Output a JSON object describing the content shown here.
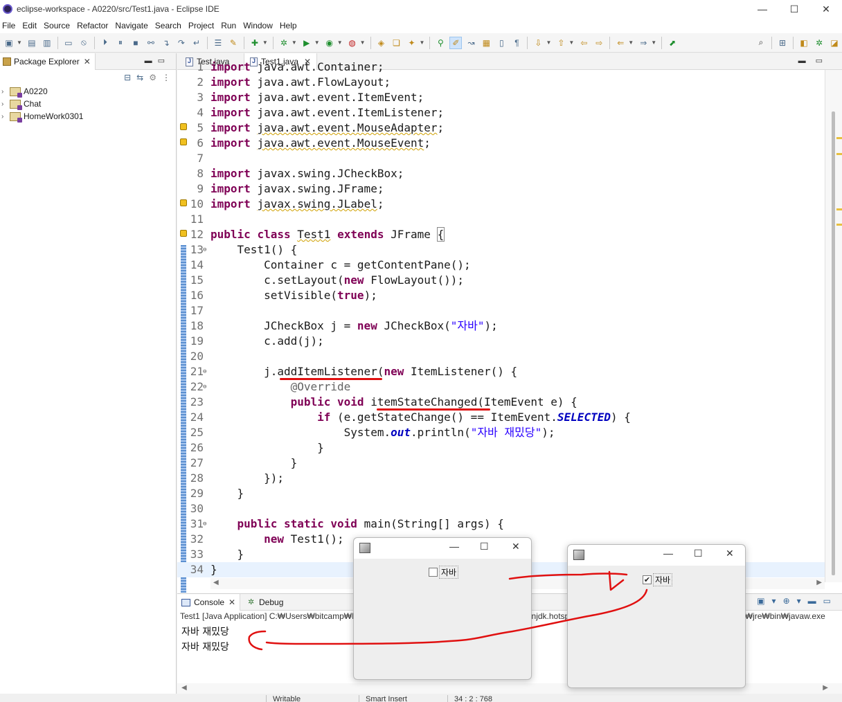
{
  "window": {
    "title": "eclipse-workspace - A0220/src/Test1.java - Eclipse IDE",
    "minimize": "—",
    "maximize": "☐",
    "close": "✕"
  },
  "menu": [
    "File",
    "Edit",
    "Source",
    "Refactor",
    "Navigate",
    "Search",
    "Project",
    "Run",
    "Window",
    "Help"
  ],
  "package_explorer": {
    "title": "Package Explorer",
    "close": "✕",
    "projects": [
      "A0220",
      "Chat",
      "HomeWork0301"
    ]
  },
  "editor": {
    "tabs": [
      {
        "label": "Test.java",
        "active": false
      },
      {
        "label": "Test1.java",
        "active": true,
        "close": "✕"
      }
    ],
    "lines": [
      {
        "n": "1",
        "html": "<span class=\"kw\">import</span> java.awt.Container;"
      },
      {
        "n": "2",
        "html": "<span class=\"kw\">import</span> java.awt.FlowLayout;"
      },
      {
        "n": "3",
        "html": "<span class=\"kw\">import</span> java.awt.event.ItemEvent;"
      },
      {
        "n": "4",
        "html": "<span class=\"kw\">import</span> java.awt.event.ItemListener;"
      },
      {
        "n": "5",
        "warn": true,
        "html": "<span class=\"kw\">import</span> <span class=\"sq\">java.awt.event.MouseAdapter</span>;"
      },
      {
        "n": "6",
        "warn": true,
        "html": "<span class=\"kw\">import</span> <span class=\"sq\">java.awt.event.MouseEvent</span>;"
      },
      {
        "n": "7",
        "html": ""
      },
      {
        "n": "8",
        "html": "<span class=\"kw\">import</span> javax.swing.JCheckBox;"
      },
      {
        "n": "9",
        "html": "<span class=\"kw\">import</span> javax.swing.JFrame;"
      },
      {
        "n": "10",
        "warn": true,
        "html": "<span class=\"kw\">import</span> <span class=\"sq\">javax.swing.JLabel</span>;"
      },
      {
        "n": "11",
        "html": ""
      },
      {
        "n": "12",
        "warn": true,
        "html": "<span class=\"kw\">public</span> <span class=\"kw\">class</span> <span class=\"sq\">Test1</span> <span class=\"kw\">extends</span> JFrame <span class=\"bracebox\">{</span>"
      },
      {
        "n": "13",
        "fold": true,
        "html": "    Test1() {"
      },
      {
        "n": "14",
        "html": "        Container c = getContentPane();"
      },
      {
        "n": "15",
        "html": "        c.setLayout(<span class=\"kw\">new</span> FlowLayout());"
      },
      {
        "n": "16",
        "html": "        setVisible(<span class=\"kw\">true</span>);"
      },
      {
        "n": "17",
        "html": ""
      },
      {
        "n": "18",
        "html": "        JCheckBox j = <span class=\"kw\">new</span> JCheckBox(<span class=\"str\">\"자바\"</span>);"
      },
      {
        "n": "19",
        "html": "        c.add(j);"
      },
      {
        "n": "20",
        "html": ""
      },
      {
        "n": "21",
        "fold": true,
        "html": "        j.addItemListener(<span class=\"kw\">new</span> ItemListener() {"
      },
      {
        "n": "22",
        "fold": true,
        "html": "            <span class=\"ann\">@Override</span>"
      },
      {
        "n": "23",
        "html": "            <span class=\"kw\">public</span> <span class=\"kw\">void</span> itemStateChanged(ItemEvent e) {"
      },
      {
        "n": "24",
        "html": "                <span class=\"kw\">if</span> (e.getStateChange() == ItemEvent.<span class=\"fld\">SELECTED</span>) {"
      },
      {
        "n": "25",
        "html": "                    System.<span class=\"fld\">out</span>.println(<span class=\"str\">\"자바 재밌당\"</span>);"
      },
      {
        "n": "26",
        "html": "                }"
      },
      {
        "n": "27",
        "html": "            }"
      },
      {
        "n": "28",
        "html": "        });"
      },
      {
        "n": "29",
        "html": "    }"
      },
      {
        "n": "30",
        "html": ""
      },
      {
        "n": "31",
        "fold": true,
        "html": "    <span class=\"kw\">public</span> <span class=\"kw\">static</span> <span class=\"kw\">void</span> main(String[] args) {"
      },
      {
        "n": "32",
        "html": "        <span class=\"kw\">new</span> Test1();"
      },
      {
        "n": "33",
        "html": "    }"
      },
      {
        "n": "34",
        "current": true,
        "html": "}"
      }
    ]
  },
  "console": {
    "tabs": [
      {
        "label": "Console",
        "active": true,
        "close": "✕"
      },
      {
        "label": "Debug",
        "active": false
      }
    ],
    "description": "Test1 [Java Application] C:₩Users₩bitcamp₩Desktop₩eclipse₩plugins₩org.eclipse.justj.openjdk.hotspot.jre.full.win32.x86_64_17.0.1.v20211116-1657₩jre₩bin₩javaw.exe",
    "output": [
      "자바  재밌당",
      "자바  재밌당"
    ]
  },
  "swing_windows": [
    {
      "checkbox_label": "자바",
      "checked": false,
      "mark": ""
    },
    {
      "checkbox_label": "자바",
      "checked": true,
      "mark": "✔"
    }
  ],
  "status": {
    "mode": "Writable",
    "insert": "Smart Insert",
    "position": "34 : 2 : 768"
  }
}
